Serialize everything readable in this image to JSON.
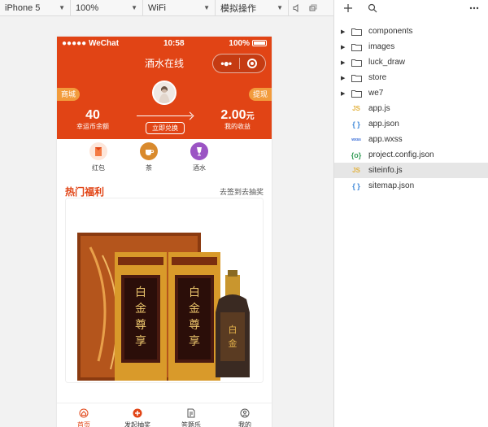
{
  "toolbar": {
    "device": "iPhone 5",
    "zoom": "100%",
    "network": "WiFi",
    "operation": "模拟操作"
  },
  "phone": {
    "status": {
      "carrier": "●●●●● WeChat",
      "time": "10:58",
      "battery": "100%"
    },
    "nav_title": "酒水在线",
    "capsule_dots": "•●•",
    "tag_left": "商城",
    "tag_right": "提现",
    "stat_left": {
      "value": "40",
      "label": "幸运币余额"
    },
    "stat_right": {
      "value": "2.00",
      "unit": "元",
      "label": "我的收益"
    },
    "redeem_label": "立即兑换",
    "categories": [
      {
        "label": "红包",
        "icon": "red-packet-icon",
        "color": "#f47a43"
      },
      {
        "label": "茶",
        "icon": "tea-icon",
        "color": "#d98a2d"
      },
      {
        "label": "酒水",
        "icon": "wine-icon",
        "color": "#9b54c4"
      }
    ],
    "section_title": "热门福利",
    "section_link": "去签到去抽奖",
    "tabs": [
      {
        "label": "首页",
        "icon": "home-icon"
      },
      {
        "label": "发起抽奖",
        "icon": "plus-circle-icon"
      },
      {
        "label": "答题乐",
        "icon": "quiz-icon"
      },
      {
        "label": "我的",
        "icon": "profile-icon"
      }
    ],
    "colors": {
      "accent": "#e14415",
      "tag": "#f29b3c"
    }
  },
  "filetree": {
    "items": [
      {
        "name": "components",
        "type": "folder"
      },
      {
        "name": "images",
        "type": "folder"
      },
      {
        "name": "luck_draw",
        "type": "folder"
      },
      {
        "name": "store",
        "type": "folder"
      },
      {
        "name": "we7",
        "type": "folder"
      },
      {
        "name": "app.js",
        "type": "js",
        "badge": "JS"
      },
      {
        "name": "app.json",
        "type": "json",
        "badge": "{ }"
      },
      {
        "name": "app.wxss",
        "type": "wxss",
        "badge": "wxss"
      },
      {
        "name": "project.config.json",
        "type": "cfg",
        "badge": "{o}"
      },
      {
        "name": "siteinfo.js",
        "type": "js",
        "badge": "JS"
      },
      {
        "name": "sitemap.json",
        "type": "json",
        "badge": "{ }"
      }
    ],
    "selected": "siteinfo.js"
  }
}
